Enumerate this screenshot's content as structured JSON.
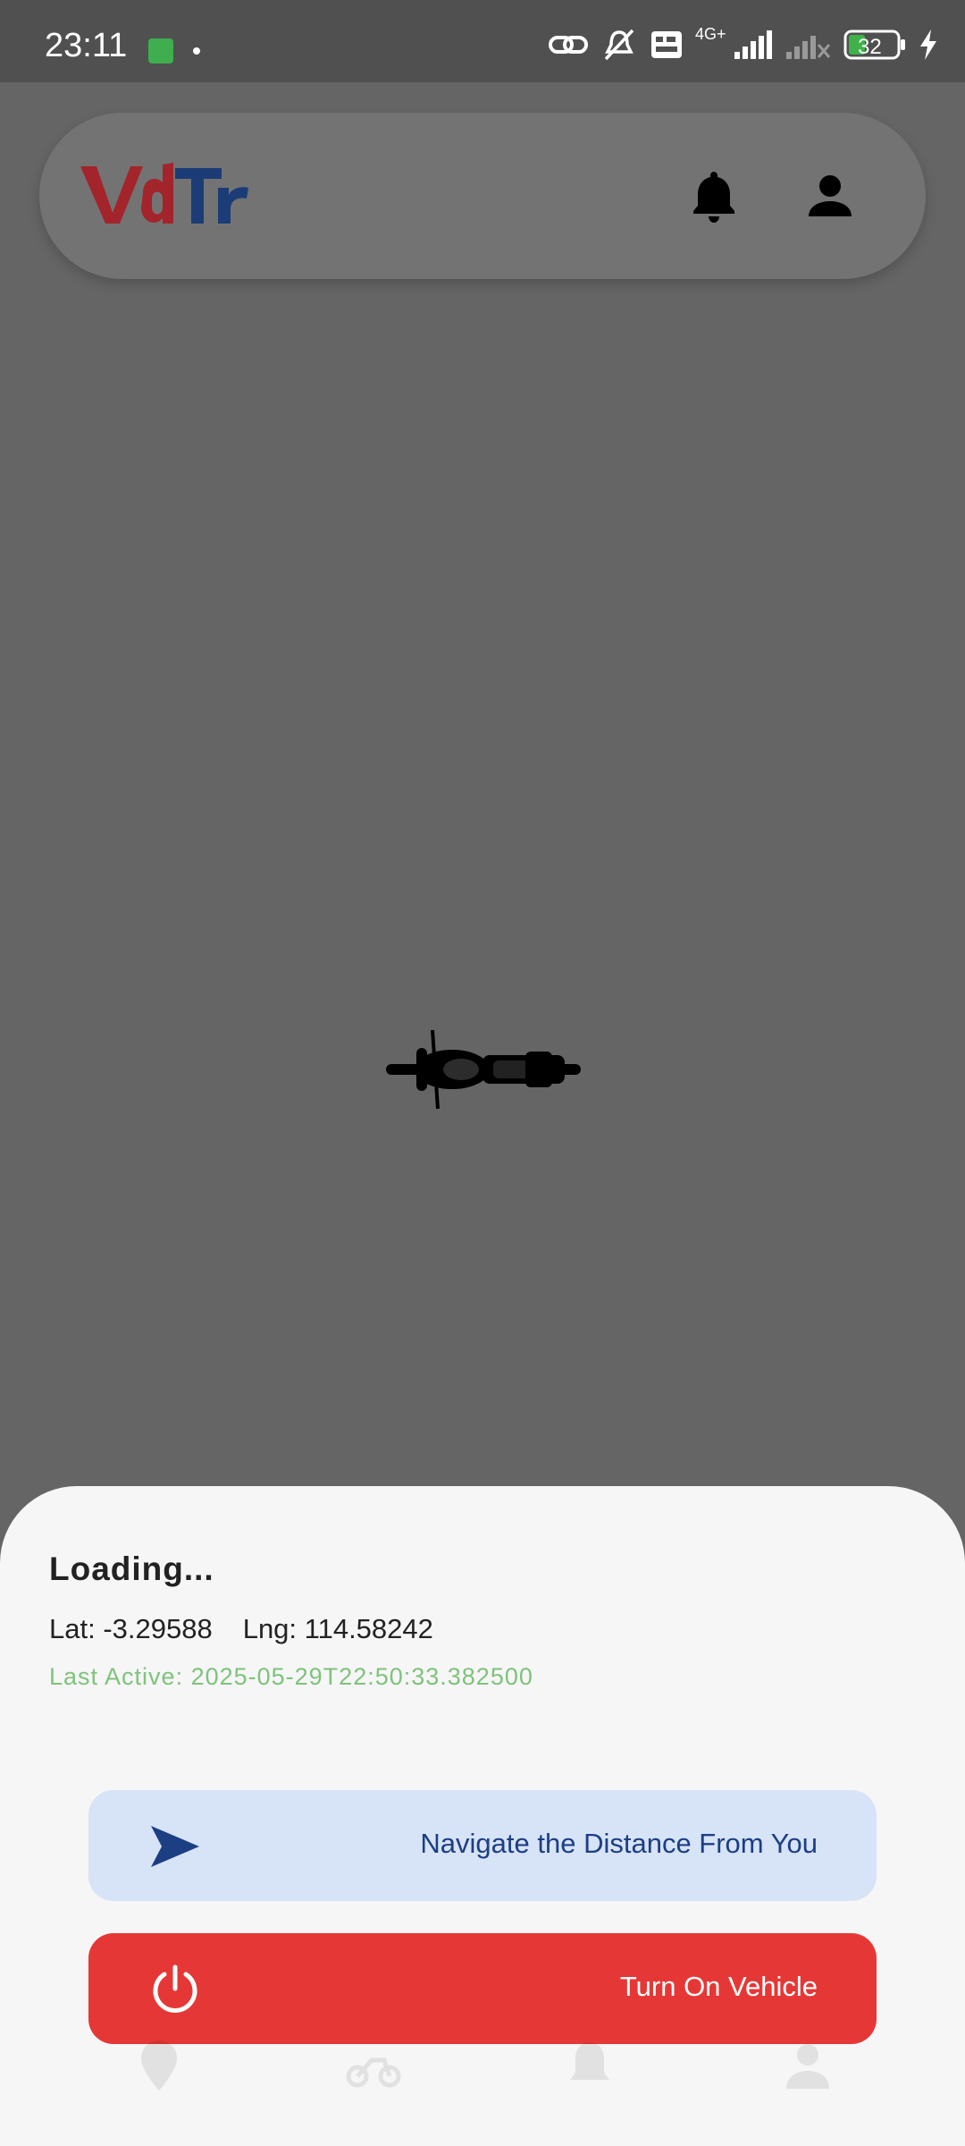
{
  "status_bar": {
    "time": "23:11",
    "network": "4G+",
    "battery": "32",
    "icons": [
      "app-notification-icon",
      "link-icon",
      "mute-icon",
      "volte-icon",
      "signal-icon",
      "no-signal-icon",
      "battery-icon",
      "charging-icon"
    ]
  },
  "header": {
    "logo_text": "VdTr",
    "logo_colors": {
      "primary": "#a3242b",
      "secondary": "#1b3c77"
    },
    "icons": [
      "bell-icon",
      "person-icon"
    ]
  },
  "map": {
    "marker_icon": "motorcycle-icon",
    "background": "#656565"
  },
  "vehicle_sheet": {
    "title": "Loading...",
    "lat": "Lat: -3.29588",
    "lng": "Lng: 114.58242",
    "last_active": "Last Active: 2025-05-29T22:50:33.382500",
    "navigate_button": {
      "label": "Navigate the Distance From You",
      "icon": "navigation-arrow-icon",
      "color": "#d7e3f6"
    },
    "power_button": {
      "label": "Turn On Vehicle",
      "icon": "power-icon",
      "color": "#e53836"
    }
  },
  "bottom_nav": {
    "items": [
      "location-pin-icon",
      "motorcycle-icon",
      "bell-icon",
      "person-icon"
    ]
  }
}
